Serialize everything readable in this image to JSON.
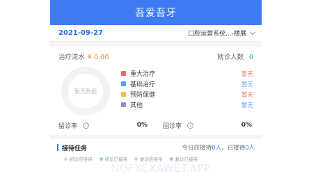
{
  "header": {
    "title": "吾爱吾牙"
  },
  "date_bar": {
    "date": "2021-09-27",
    "clinic": "口腔运营系统...-楼展"
  },
  "stats": {
    "flow_label": "治疗流水",
    "flow_value": "¥ 0.00",
    "visitors_label": "就诊人数",
    "visitors_value": "0",
    "empty_text": "暂无数据",
    "legend": [
      {
        "label": "重大治疗",
        "value": "暂无",
        "color": "#e86a6a",
        "value_color": "#e86a6a"
      },
      {
        "label": "基础治疗",
        "value": "暂无",
        "color": "#5aa0f0",
        "value_color": "#5aa0f0"
      },
      {
        "label": "预防保健",
        "value": "暂无",
        "color": "#f2c12e",
        "value_color": "#e86a6a"
      },
      {
        "label": "其他",
        "value": "暂无",
        "color": "#9a83d8",
        "value_color": "#5aa0f0"
      }
    ],
    "retention_label": "留诊率",
    "retention_value": "0%",
    "return_label": "回诊率",
    "return_value": "0%",
    "info_glyph": "i"
  },
  "tasks": {
    "title": "接待任务",
    "summary_prefix": "今日应接待",
    "due_count": "0人",
    "summary_mid": "、已接待",
    "done_count": "0人",
    "statuses": [
      {
        "label": "初诊应接待",
        "color": "#bfe8dc"
      },
      {
        "label": "初诊已接待",
        "color": "#8fd9c0"
      },
      {
        "label": "复诊应接待",
        "color": "#c9d8f5"
      },
      {
        "label": "复诊已接待",
        "color": "#a9bff0"
      }
    ]
  },
  "watermark": "NOFXCXAWET.APP"
}
